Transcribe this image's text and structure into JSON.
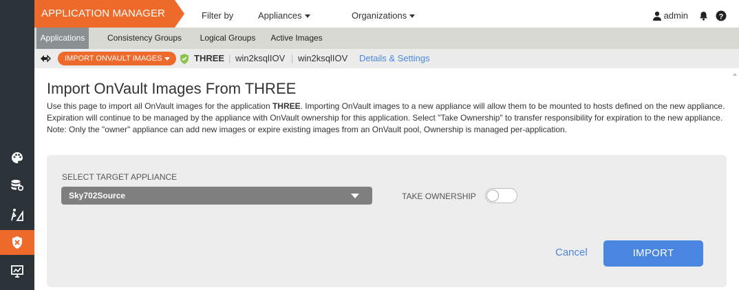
{
  "header": {
    "brand": "APPLICATION MANAGER",
    "filter_by": "Filter by",
    "appliances": "Appliances",
    "organizations": "Organizations",
    "user": "admin"
  },
  "tabs": [
    {
      "label": "Applications",
      "active": true
    },
    {
      "label": "Consistency Groups",
      "active": false
    },
    {
      "label": "Logical Groups",
      "active": false
    },
    {
      "label": "Active Images",
      "active": false
    }
  ],
  "breadcrumb": {
    "action": "IMPORT ONVAULT IMAGES",
    "app": "THREE",
    "host1": "win2ksqlIOV",
    "host2": "win2ksqlIOV",
    "details": "Details & Settings"
  },
  "main": {
    "title": "Import OnVault Images From THREE",
    "desc_part1": "Use this page to import all OnVault images for the application ",
    "desc_bold": "THREE",
    "desc_part2": ". Importing OnVault images to a new appliance will allow them to be mounted to hosts defined on the new appliance. Expiration will continue to be managed by the appliance with OnVault ownership for this application. Select \"Take Ownership\" to transfer responsibility for expiration to the new appliance. Note: Only the \"owner\" appliance can add new images or expire existing images from an OnVault pool, Ownership is managed per-application."
  },
  "form": {
    "target_label": "SELECT TARGET APPLIANCE",
    "target_value": "Sky702Source",
    "ownership_label": "TAKE OWNERSHIP",
    "ownership_on": false,
    "cancel": "Cancel",
    "import": "IMPORT"
  },
  "icons": {
    "rail": [
      "palette-icon",
      "database-gear-icon",
      "workflow-icon",
      "shield-icon",
      "monitor-chart-icon"
    ],
    "top": [
      "user-icon",
      "bell-icon",
      "help-icon"
    ]
  },
  "colors": {
    "accent_orange": "#ee6a2a",
    "primary_blue": "#4a86e0",
    "rail_dark": "#2b3339",
    "shield_green": "#8bc34a"
  }
}
